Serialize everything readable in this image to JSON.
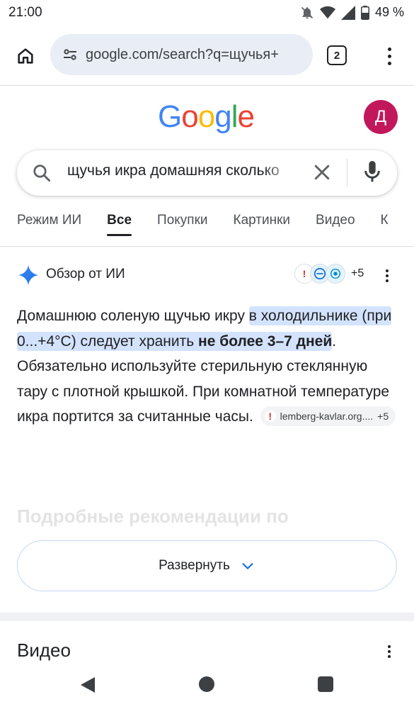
{
  "status_bar": {
    "time": "21:00",
    "battery": "49 %",
    "icons": [
      "notifications-off-icon",
      "wifi-icon",
      "signal-icon",
      "battery-icon"
    ]
  },
  "browser": {
    "url": "google.com/search?q=щучья+",
    "tab_count": "2"
  },
  "google": {
    "logo_text": [
      "G",
      "o",
      "o",
      "g",
      "l",
      "e"
    ],
    "logo_colors": [
      "#4285F4",
      "#EA4335",
      "#FBBC05",
      "#4285F4",
      "#34A853",
      "#EA4335"
    ],
    "avatar_letter": "Д",
    "avatar_color": "#c2185b"
  },
  "search": {
    "query": "щучья икра домашняя сколько"
  },
  "tabs": [
    {
      "label": "Режим ИИ",
      "active": false
    },
    {
      "label": "Все",
      "active": true
    },
    {
      "label": "Покупки",
      "active": false
    },
    {
      "label": "Картинки",
      "active": false
    },
    {
      "label": "Видео",
      "active": false
    },
    {
      "label": "К",
      "active": false
    }
  ],
  "ai_overview": {
    "title": "Обзор от ИИ",
    "sources_more": "+5",
    "body_lead": "Домашнюю соленую щучью икру ",
    "body_highlight_pre": "в холодильнике (при 0...+4°C) следует хранить ",
    "body_highlight_bold": "не более 3–7 дней",
    "body_rest": ". Обязательно используйте стерильную стеклянную тару с плотной крышкой. При комнатной температуре икра портится за считанные часы.",
    "citation_domain": "lemberg-kavlar.org....",
    "citation_more": "+5",
    "faded_heading": "Подробные рекомендации по",
    "expand_label": "Развернуть"
  },
  "videos": {
    "heading": "Видео"
  },
  "colors": {
    "highlight": "#d3e3fd",
    "accent_blue": "#1a73e8",
    "section_gap": "#eff1f3"
  }
}
